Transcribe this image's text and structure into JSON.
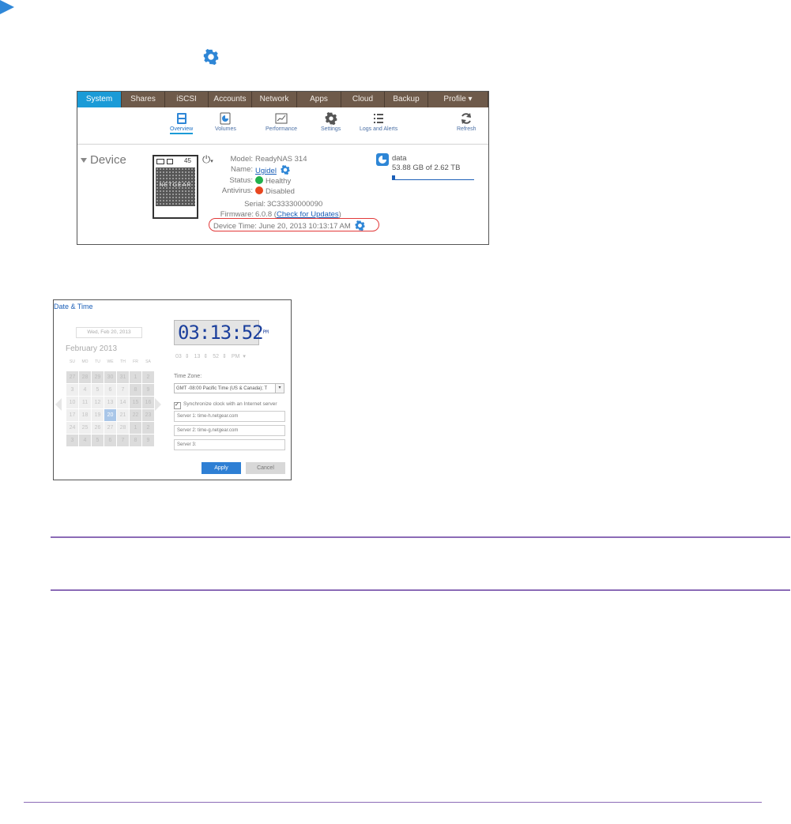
{
  "colors": {
    "accent": "#1b9bd7",
    "nav_bg": "#6e5a4a",
    "note_rule": "#8b6bb6",
    "highlight": "#e23a3a",
    "healthy": "#22b14c",
    "disabled": "#e8461f"
  },
  "nav": {
    "tabs": [
      {
        "label": "System",
        "active": true
      },
      {
        "label": "Shares"
      },
      {
        "label": "iSCSI"
      },
      {
        "label": "Accounts"
      },
      {
        "label": "Network"
      },
      {
        "label": "Apps"
      },
      {
        "label": "Cloud"
      },
      {
        "label": "Backup"
      },
      {
        "label": "Profile ▾"
      }
    ]
  },
  "toolbar": {
    "overview": "Overview",
    "volumes": "Volumes",
    "performance": "Performance",
    "settings": "Settings",
    "logs": "Logs and Alerts",
    "refresh": "Refresh"
  },
  "device": {
    "title": "Device",
    "badge": "45",
    "front_label": "NETGEAR",
    "model_label": "Model:",
    "model_value": "ReadyNAS 314",
    "name_label": "Name:",
    "name_value": "Ugidel",
    "status_label": "Status:",
    "status_value": "Healthy",
    "antivirus_label": "Antivirus:",
    "antivirus_value": "Disabled",
    "serial_label": "Serial:",
    "serial_value": "3C33330000090",
    "firmware_label": "Firmware:",
    "firmware_value": "6.0.8",
    "firmware_link": "Check for Updates",
    "device_time": "Device Time: June 20, 2013 10:13:17 AM"
  },
  "volume": {
    "name": "data",
    "usage": "53.88 GB of 2.62 TB",
    "used_fraction": 0.02
  },
  "dialog": {
    "title": "Date & Time",
    "date_value": "Wed, Feb 20, 2013",
    "month": "February 2013",
    "dow": [
      "SU",
      "MO",
      "TU",
      "WE",
      "TH",
      "FR",
      "SA"
    ],
    "clock_hm": "03:13:52",
    "clock_ampm": "PM",
    "hour": "03",
    "minute": "13",
    "second": "52",
    "ampm": "PM",
    "timezone_label": "Time Zone:",
    "timezone_value": "GMT -08:00 Pacific Time (US & Canada); T",
    "sync_label": "Synchronize clock with an Internet server",
    "server1": "Server 1:   time-h.netgear.com",
    "server2": "Server 2:   time-g.netgear.com",
    "server3": "Server 3:",
    "apply": "Apply",
    "cancel": "Cancel"
  },
  "calendar": {
    "rows": [
      [
        "27",
        "28",
        "29",
        "30",
        "31",
        "1",
        "2"
      ],
      [
        "3",
        "4",
        "5",
        "6",
        "7",
        "8",
        "9"
      ],
      [
        "10",
        "11",
        "12",
        "13",
        "14",
        "15",
        "16"
      ],
      [
        "17",
        "18",
        "19",
        "20",
        "21",
        "22",
        "23"
      ],
      [
        "24",
        "25",
        "26",
        "27",
        "28",
        "1",
        "2"
      ],
      [
        "3",
        "4",
        "5",
        "6",
        "7",
        "8",
        "9"
      ]
    ],
    "selected": "20"
  }
}
